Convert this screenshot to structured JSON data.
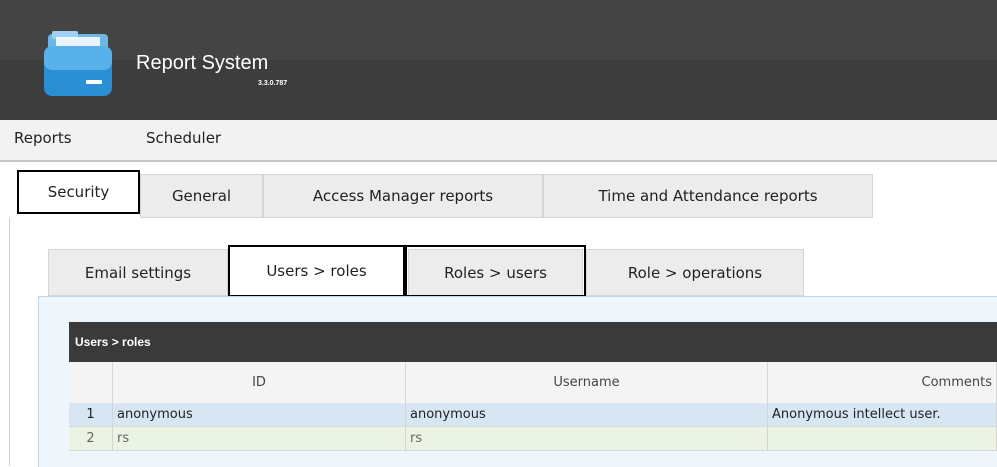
{
  "header": {
    "app_title": "Report System",
    "version": "3.3.0.787",
    "icon": "report-folder-icon"
  },
  "menu": {
    "items": [
      "Reports",
      "Scheduler"
    ]
  },
  "tabs": [
    {
      "label": "Security",
      "active": true
    },
    {
      "label": "General"
    },
    {
      "label": "Access Manager reports"
    },
    {
      "label": "Time and Attendance reports"
    }
  ],
  "subtabs": [
    {
      "label": "Email settings"
    },
    {
      "label": "Users > roles",
      "active": true
    },
    {
      "label": "Roles > users"
    },
    {
      "label": "Role > operations"
    }
  ],
  "grid": {
    "title": "Users > roles",
    "columns": [
      "",
      "ID",
      "Username",
      "Comments"
    ],
    "rows": [
      [
        "1",
        "anonymous",
        "anonymous",
        "Anonymous intellect user."
      ],
      [
        "2",
        "rs",
        "rs",
        ""
      ]
    ]
  },
  "colors": {
    "header_bg": "#3d3d3d",
    "selected_row": "#d8e6f3",
    "alt_row": "#eaf3e4"
  }
}
